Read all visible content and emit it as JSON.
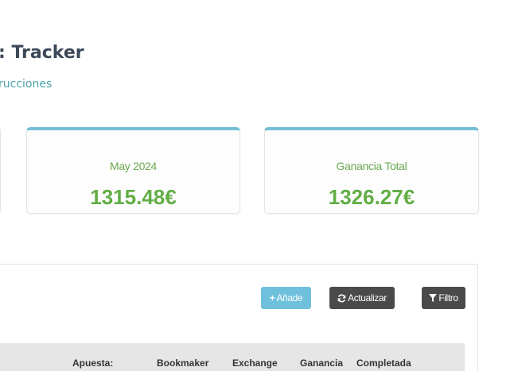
{
  "header": {
    "title": ": Tracker",
    "instructions_link": "rucciones"
  },
  "stats": {
    "month": {
      "label": "May 2024",
      "value": "1315.48€"
    },
    "total": {
      "label": "Ganancia Total",
      "value": "1326.27€"
    }
  },
  "toolbar": {
    "add_label": "Añade",
    "refresh_label": "Actualizar",
    "filter_label": "Filtro"
  },
  "table": {
    "columns": [
      "Apuesta:",
      "Bookmaker",
      "Exchange",
      "Ganancia",
      "Completada"
    ]
  },
  "colors": {
    "accent": "#73bfd6",
    "value_green": "#62ae45",
    "button_dark": "#4a4a4a",
    "button_info": "#6fc0dc"
  }
}
